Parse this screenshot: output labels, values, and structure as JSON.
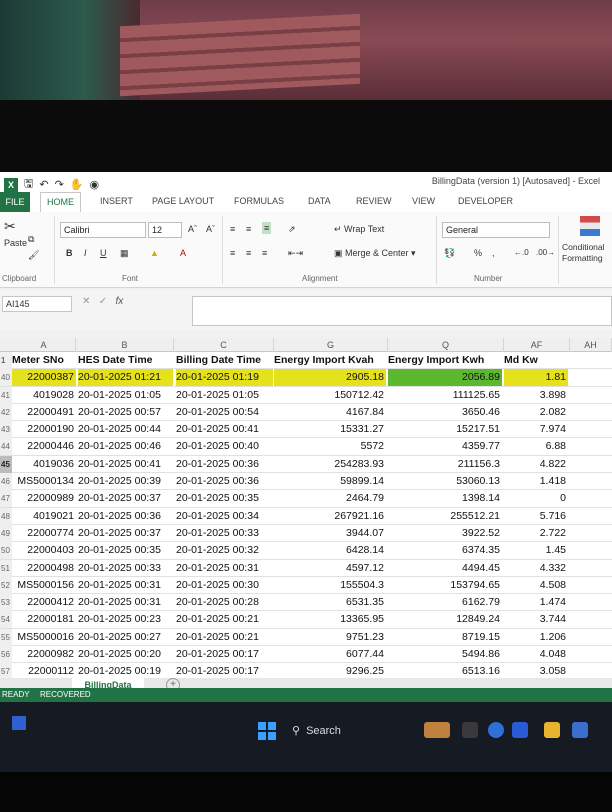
{
  "window": {
    "title": "BillingData (version 1) [Autosaved] - Excel"
  },
  "ribbon": {
    "tabs": [
      "FILE",
      "HOME",
      "INSERT",
      "PAGE LAYOUT",
      "FORMULAS",
      "DATA",
      "REVIEW",
      "VIEW",
      "DEVELOPER"
    ],
    "font_name": "Calibri",
    "font_size": "12",
    "wrap_text": "Wrap Text",
    "merge_center": "Merge & Center",
    "number_format": "General",
    "conditional_formatting": "Conditional Formatting",
    "paste": "Paste",
    "groups": {
      "clipboard": "Clipboard",
      "font": "Font",
      "alignment": "Alignment",
      "number": "Number"
    }
  },
  "formula_bar": {
    "name_box": "AI145",
    "formula": ""
  },
  "columns": [
    "A",
    "B",
    "C",
    "G",
    "Q",
    "AF",
    "AH"
  ],
  "table": {
    "headers": [
      "Meter SNo",
      "HES Date Time",
      "Billing Date Time",
      "Energy Import Kvah",
      "Energy Import Kwh",
      "Md Kw"
    ],
    "rows": [
      {
        "n": "40",
        "meter": "22000387",
        "hes": "20-01-2025 01:21",
        "bill": "20-01-2025 01:19",
        "kvah": "2905.18",
        "kwh": "2056.89",
        "md": "1.81"
      },
      {
        "n": "41",
        "meter": "4019028",
        "hes": "20-01-2025 01:05",
        "bill": "20-01-2025 01:05",
        "kvah": "150712.42",
        "kwh": "111125.65",
        "md": "3.898"
      },
      {
        "n": "42",
        "meter": "22000491",
        "hes": "20-01-2025 00:57",
        "bill": "20-01-2025 00:54",
        "kvah": "4167.84",
        "kwh": "3650.46",
        "md": "2.082"
      },
      {
        "n": "43",
        "meter": "22000190",
        "hes": "20-01-2025 00:44",
        "bill": "20-01-2025 00:41",
        "kvah": "15331.27",
        "kwh": "15217.51",
        "md": "7.974"
      },
      {
        "n": "44",
        "meter": "22000446",
        "hes": "20-01-2025 00:46",
        "bill": "20-01-2025 00:40",
        "kvah": "5572",
        "kwh": "4359.77",
        "md": "6.88"
      },
      {
        "n": "45",
        "meter": "4019036",
        "hes": "20-01-2025 00:41",
        "bill": "20-01-2025 00:36",
        "kvah": "254283.93",
        "kwh": "211156.3",
        "md": "4.822"
      },
      {
        "n": "46",
        "meter": "MS5000134",
        "hes": "20-01-2025 00:39",
        "bill": "20-01-2025 00:36",
        "kvah": "59899.14",
        "kwh": "53060.13",
        "md": "1.418"
      },
      {
        "n": "47",
        "meter": "22000989",
        "hes": "20-01-2025 00:37",
        "bill": "20-01-2025 00:35",
        "kvah": "2464.79",
        "kwh": "1398.14",
        "md": "0"
      },
      {
        "n": "48",
        "meter": "4019021",
        "hes": "20-01-2025 00:36",
        "bill": "20-01-2025 00:34",
        "kvah": "267921.16",
        "kwh": "255512.21",
        "md": "5.716"
      },
      {
        "n": "49",
        "meter": "22000774",
        "hes": "20-01-2025 00:37",
        "bill": "20-01-2025 00:33",
        "kvah": "3944.07",
        "kwh": "3922.52",
        "md": "2.722"
      },
      {
        "n": "50",
        "meter": "22000403",
        "hes": "20-01-2025 00:35",
        "bill": "20-01-2025 00:32",
        "kvah": "6428.14",
        "kwh": "6374.35",
        "md": "1.45"
      },
      {
        "n": "51",
        "meter": "22000498",
        "hes": "20-01-2025 00:33",
        "bill": "20-01-2025 00:31",
        "kvah": "4597.12",
        "kwh": "4494.45",
        "md": "4.332"
      },
      {
        "n": "52",
        "meter": "MS5000156",
        "hes": "20-01-2025 00:31",
        "bill": "20-01-2025 00:30",
        "kvah": "155504.3",
        "kwh": "153794.65",
        "md": "4.508"
      },
      {
        "n": "53",
        "meter": "22000412",
        "hes": "20-01-2025 00:31",
        "bill": "20-01-2025 00:28",
        "kvah": "6531.35",
        "kwh": "6162.79",
        "md": "1.474"
      },
      {
        "n": "54",
        "meter": "22000181",
        "hes": "20-01-2025 00:23",
        "bill": "20-01-2025 00:21",
        "kvah": "13365.95",
        "kwh": "12849.24",
        "md": "3.744"
      },
      {
        "n": "55",
        "meter": "MS5000016",
        "hes": "20-01-2025 00:27",
        "bill": "20-01-2025 00:21",
        "kvah": "9751.23",
        "kwh": "8719.15",
        "md": "1.206"
      },
      {
        "n": "56",
        "meter": "22000982",
        "hes": "20-01-2025 00:20",
        "bill": "20-01-2025 00:17",
        "kvah": "6077.44",
        "kwh": "5494.86",
        "md": "4.048"
      },
      {
        "n": "57",
        "meter": "22000112",
        "hes": "20-01-2025 00:19",
        "bill": "20-01-2025 00:17",
        "kvah": "9296.25",
        "kwh": "6513.16",
        "md": "3.058"
      }
    ]
  },
  "sheet_tab": "BillingData",
  "status": {
    "ready": "READY",
    "recovered": "RECOVERED"
  },
  "taskbar": {
    "search_label": "Search"
  },
  "colors": {
    "excel_green": "#217346",
    "highlight_yellow": "#e5e21c",
    "highlight_green": "#5cb82e"
  }
}
